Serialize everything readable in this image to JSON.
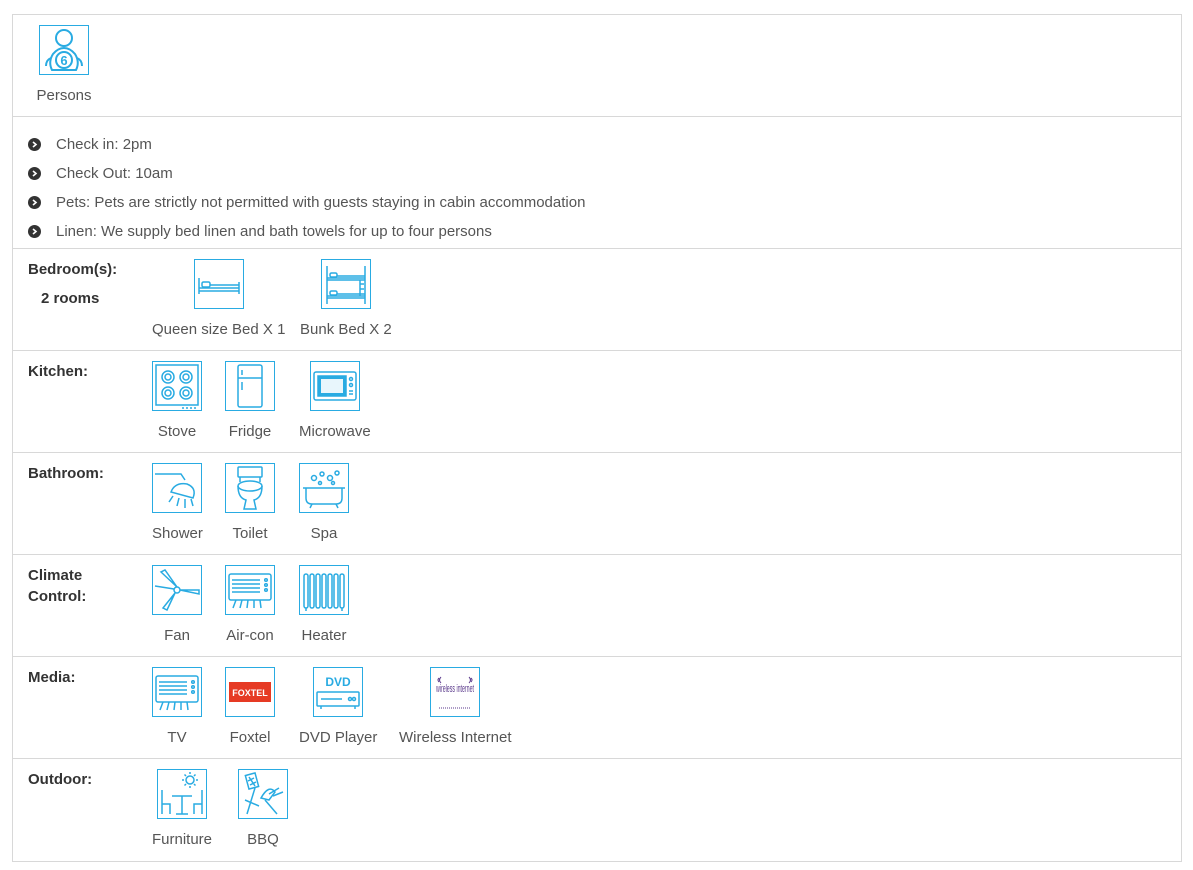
{
  "persons": {
    "count": "6",
    "label": "Persons"
  },
  "info": [
    "Check in: 2pm",
    "Check Out: 10am",
    "Pets: Pets are strictly not permitted with guests staying in cabin accommodation",
    "Linen: We supply bed linen and bath towels for up to four persons"
  ],
  "bedrooms": {
    "label": "Bedroom(s):",
    "rooms": "2 rooms",
    "items": [
      "Queen size Bed X 1",
      "Bunk Bed X 2"
    ]
  },
  "kitchen": {
    "label": "Kitchen:",
    "items": [
      "Stove",
      "Fridge",
      "Microwave"
    ]
  },
  "bathroom": {
    "label": "Bathroom:",
    "items": [
      "Shower",
      "Toilet",
      "Spa"
    ]
  },
  "climate": {
    "label": "Climate Control:",
    "items": [
      "Fan",
      "Air-con",
      "Heater"
    ]
  },
  "media": {
    "label": "Media:",
    "items": [
      "TV",
      "Foxtel",
      "DVD Player",
      "Wireless Internet"
    ],
    "foxtel_logo": "FOXTEL",
    "dvd_logo": "DVD",
    "wireless_logo": "wireless internet"
  },
  "outdoor": {
    "label": "Outdoor:",
    "items": [
      "Furniture",
      "BBQ"
    ]
  },
  "colors": {
    "icon_blue": "#29abe2",
    "foxtel_red": "#e63a24",
    "wireless_purple": "#5b3a8c"
  }
}
